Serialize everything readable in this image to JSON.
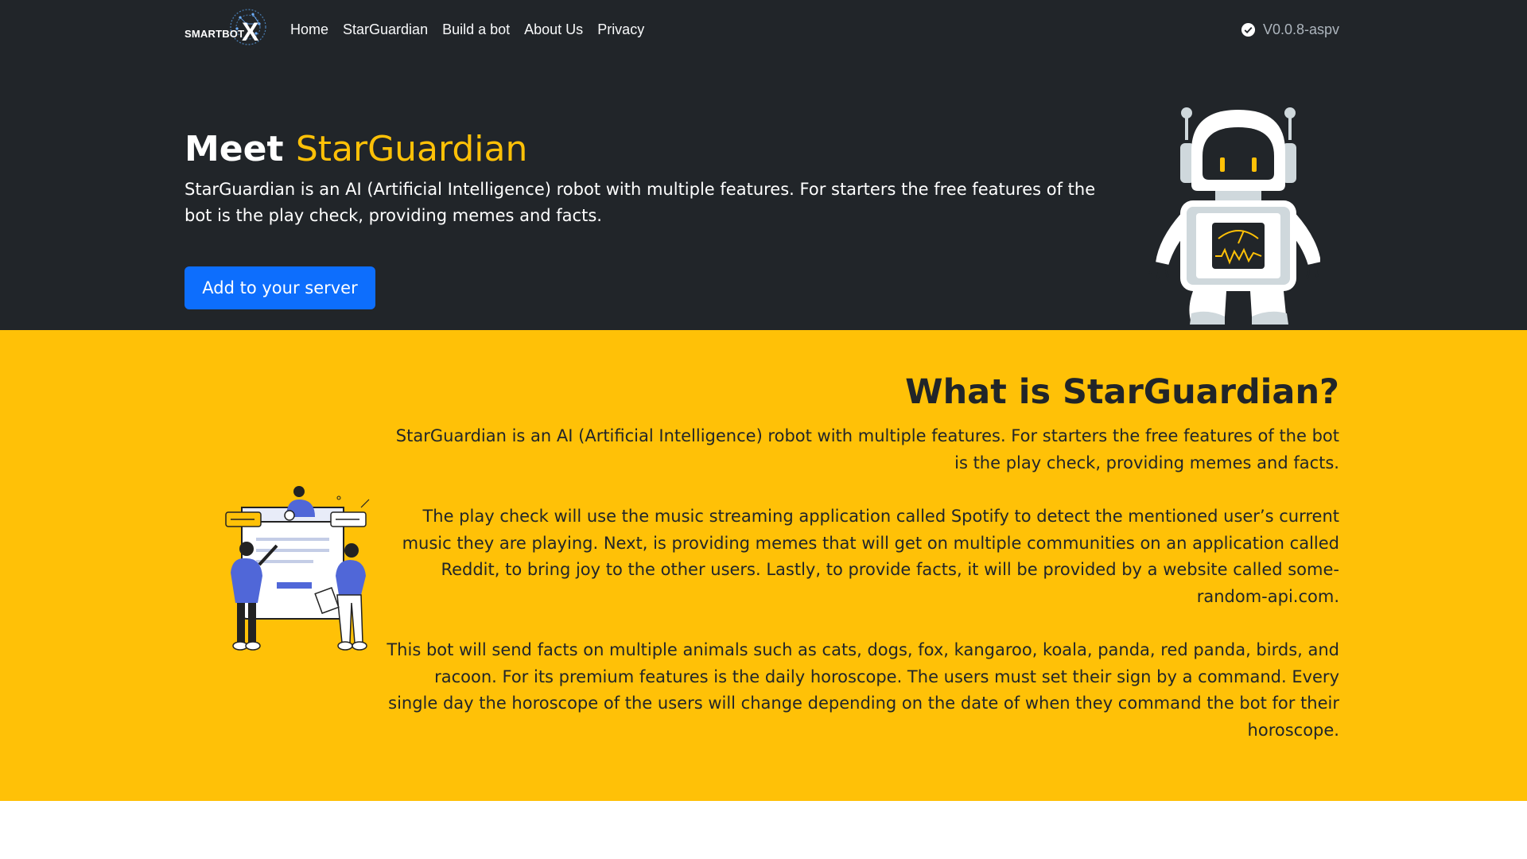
{
  "nav": {
    "logo_text": "SMARTBOT",
    "logo_x": "X",
    "links": [
      "Home",
      "StarGuardian",
      "Build a bot",
      "About Us",
      "Privacy"
    ],
    "version": "V0.0.8-aspv",
    "version_icon": "check-circle-icon"
  },
  "hero": {
    "title_prefix": "Meet",
    "title_accent": "StarGuardian",
    "description": "StarGuardian is an AI (Artificial Intelligence) robot with multiple features. For starters the free features of the bot is the play check, providing memes and facts.",
    "cta_label": "Add to your server",
    "image": "robot-illustration"
  },
  "about": {
    "title": "What is StarGuardian?",
    "paragraphs": [
      "StarGuardian is an AI (Artificial Intelligence) robot with multiple features. For starters the free features of the bot is the play check, providing memes and facts.",
      "The play check will use the music streaming application called Spotify to detect the mentioned user’s current music they are playing. Next, is providing memes that will get on multiple communities on an application called Reddit, to bring joy to the other users. Lastly, to provide facts, it will be provided by a website called some-random-api.com.",
      "This bot will send facts on multiple animals such as cats, dogs, fox, kangaroo, koala, panda, red panda, birds, and racoon. For its premium features is the daily horoscope. The users must set their sign by a command. Every single day the horoscope of the users will change depending on the date of when they command the bot for their horoscope."
    ],
    "image": "team-illustration"
  },
  "colors": {
    "dark_bg": "#212529",
    "accent_yellow": "#ffc107",
    "primary_blue": "#0d6efd",
    "text_dark": "#212529"
  }
}
